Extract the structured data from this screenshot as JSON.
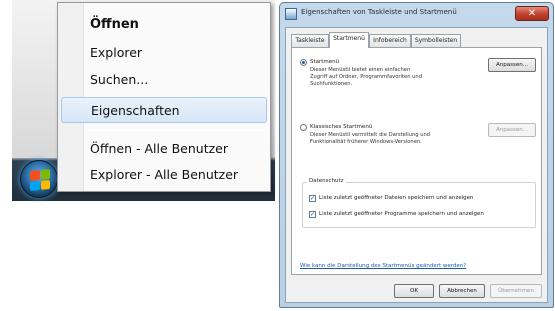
{
  "context_menu": {
    "items": [
      {
        "label": "Öffnen",
        "bold": true
      },
      {
        "label": "Explorer"
      },
      {
        "label": "Suchen..."
      },
      {
        "label": "Eigenschaften",
        "highlighted": true
      },
      {
        "label": "Öffnen - Alle Benutzer"
      },
      {
        "label": "Explorer - Alle Benutzer"
      }
    ]
  },
  "start_orb": {
    "icon": "windows-flag-icon"
  },
  "dialog": {
    "title": "Eigenschaften von Taskleiste und Startmenü",
    "close_glyph": "✕",
    "tabs": [
      {
        "label": "Taskleiste"
      },
      {
        "label": "Startmenü",
        "active": true
      },
      {
        "label": "Infobereich"
      },
      {
        "label": "Symbolleisten"
      }
    ],
    "startmenu_option": {
      "label": "Startmenü",
      "selected": true,
      "description": [
        "Dieser Menüstil bietet einen einfachen",
        "Zugriff auf Ordner, Programmfavoriten und",
        "Suchfunktionen."
      ],
      "button": "Anpassen..."
    },
    "classic_option": {
      "label": "Klassisches Startmenü",
      "selected": false,
      "description": [
        "Dieser Menüstil vermittelt die Darstellung und",
        "Funktionalität früherer Windows-Versionen."
      ],
      "button": "Anpassen..."
    },
    "privacy": {
      "title": "Datenschutz",
      "items": [
        {
          "label": "Liste zuletzt geöffneter Dateien speichern und anzeigen",
          "checked": true
        },
        {
          "label": "Liste zuletzt geöffneter Programme speichern und anzeigen",
          "checked": true
        }
      ]
    },
    "help_link": "Wie kann die Darstellung des Startmenüs geändert werden?",
    "buttons": {
      "ok": "OK",
      "cancel": "Abbrechen",
      "apply": "Übernehmen"
    }
  }
}
